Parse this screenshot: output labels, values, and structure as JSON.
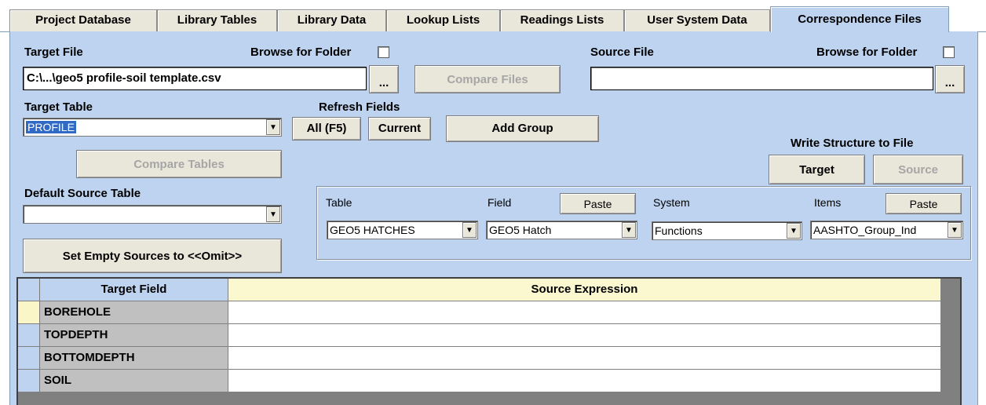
{
  "tabs": [
    {
      "label": "Project Database"
    },
    {
      "label": "Library Tables"
    },
    {
      "label": "Library Data"
    },
    {
      "label": "Lookup Lists"
    },
    {
      "label": "Readings Lists"
    },
    {
      "label": "User System Data"
    },
    {
      "label": "Correspondence Files"
    }
  ],
  "target": {
    "file_label": "Target File",
    "browse_label": "Browse for Folder",
    "file_value": "C:\\...\\geo5 profile-soil template.csv",
    "ellipsis": "...",
    "table_label": "Target Table",
    "table_value": "PROFILE"
  },
  "compare_files_label": "Compare Files",
  "source": {
    "file_label": "Source File",
    "browse_label": "Browse for Folder",
    "file_value": "",
    "ellipsis": "..."
  },
  "refresh": {
    "label": "Refresh Fields",
    "all_label": "All (F5)",
    "current_label": "Current",
    "add_group_label": "Add Group"
  },
  "compare_tables_label": "Compare Tables",
  "write_structure": {
    "label": "Write Structure to File",
    "target_label": "Target",
    "source_label": "Source"
  },
  "default_source": {
    "label": "Default Source Table",
    "value": ""
  },
  "set_empty_label": "Set Empty Sources to <<Omit>>",
  "pickers": {
    "table_label": "Table",
    "table_value": "GEO5 HATCHES",
    "field_label": "Field",
    "field_value": "GEO5 Hatch",
    "paste_label": "Paste",
    "system_label": "System",
    "system_value": "Functions",
    "items_label": "Items",
    "items_value": "AASHTO_Group_Ind",
    "paste2_label": "Paste"
  },
  "grid": {
    "headers": {
      "target_field": "Target Field",
      "source_expression": "Source Expression"
    },
    "rows": [
      {
        "target_field": "BOREHOLE",
        "source_expression": ""
      },
      {
        "target_field": "TOPDEPTH",
        "source_expression": ""
      },
      {
        "target_field": "BOTTOMDEPTH",
        "source_expression": ""
      },
      {
        "target_field": "SOIL",
        "source_expression": ""
      }
    ]
  },
  "icons": {
    "dropdown": "chevron-down-icon"
  },
  "colors": {
    "panel": "#bdd3ef",
    "tab": "#e9e6da",
    "selection": "#316ac5",
    "current_row": "#fbf6c8"
  }
}
